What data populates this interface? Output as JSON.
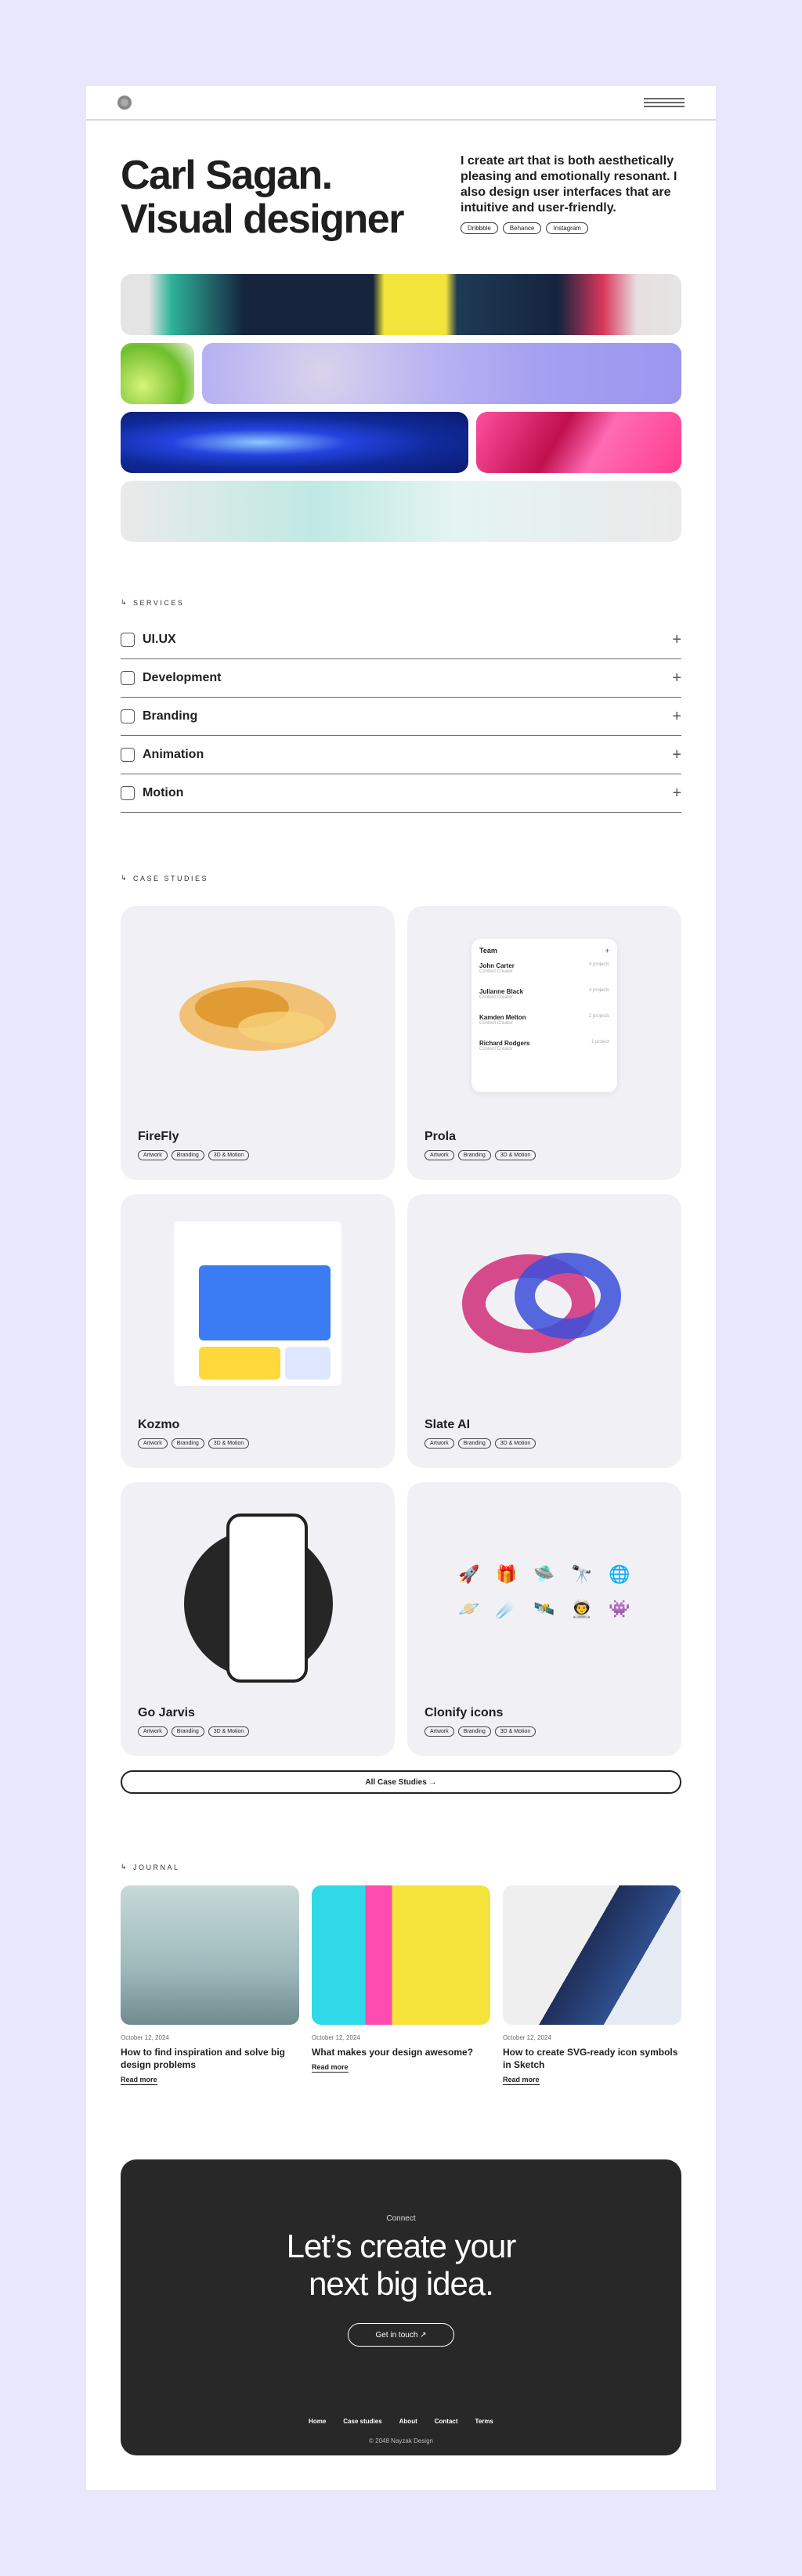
{
  "header": {
    "logo": "logo",
    "menu_icon": "menu-icon"
  },
  "hero": {
    "name": "Carl Sagan.",
    "role": "Visual designer",
    "tagline": "I create art that is both aesthetically pleasing and emotionally resonant. I also design user interfaces that are intuitive and user-friendly.",
    "links": [
      "Dribbble",
      "Behance",
      "Instagram"
    ]
  },
  "services": {
    "label": "SERVICES",
    "items": [
      {
        "name": "UI.UX",
        "icon": "uiux-icon"
      },
      {
        "name": "Development",
        "icon": "development-icon"
      },
      {
        "name": "Branding",
        "icon": "branding-icon"
      },
      {
        "name": "Animation",
        "icon": "animation-icon"
      },
      {
        "name": "Motion",
        "icon": "motion-icon"
      }
    ]
  },
  "case_studies": {
    "label": "CASE STUDIES",
    "cards": [
      {
        "title": "FireFly",
        "tags": [
          "Artwork",
          "Branding",
          "3D & Motion"
        ]
      },
      {
        "title": "Prola",
        "tags": [
          "Artwork",
          "Branding",
          "3D & Motion"
        ]
      },
      {
        "title": "Kozmo",
        "tags": [
          "Artwork",
          "Branding",
          "3D & Motion"
        ]
      },
      {
        "title": "Slate AI",
        "tags": [
          "Artwork",
          "Branding",
          "3D & Motion"
        ]
      },
      {
        "title": "Go Jarvis",
        "tags": [
          "Artwork",
          "Branding",
          "3D & Motion"
        ]
      },
      {
        "title": "Clonify icons",
        "tags": [
          "Artwork",
          "Branding",
          "3D & Motion"
        ]
      }
    ],
    "prola_team": {
      "title": "Team",
      "members": [
        {
          "name": "John Carter",
          "role": "Content Creator",
          "status": "4 projects"
        },
        {
          "name": "Julianne Black",
          "role": "Content Creator",
          "status": "4 projects"
        },
        {
          "name": "Kamden Melton",
          "role": "Content Creator",
          "status": "2 projects"
        },
        {
          "name": "Richard Rodgers",
          "role": "Content Creator",
          "status": "1 project"
        }
      ]
    },
    "all_button": "All Case Studies →"
  },
  "journal": {
    "label": "JOURNAL",
    "posts": [
      {
        "date": "October 12, 2024",
        "title": "How to find inspiration and solve big design problems",
        "more": "Read more"
      },
      {
        "date": "October 12, 2024",
        "title": "What makes your design awesome?",
        "more": "Read more"
      },
      {
        "date": "October 12, 2024",
        "title": "How to create SVG-ready icon symbols in Sketch",
        "more": "Read more"
      }
    ]
  },
  "cta": {
    "kicker": "Connect",
    "headline_1": "Let’s create your",
    "headline_2": "next big idea.",
    "button": "Get in touch ↗"
  },
  "footer": {
    "links": [
      "Home",
      "Case studies",
      "About",
      "Contact",
      "Terms"
    ],
    "copyright": "© 2048 Nayzak Design"
  }
}
